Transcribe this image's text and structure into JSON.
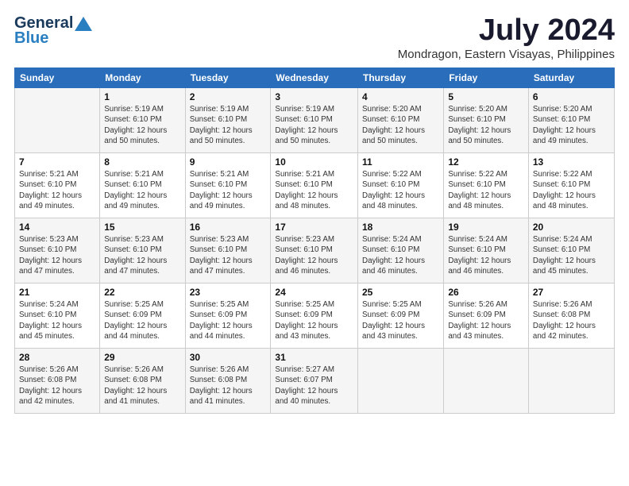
{
  "header": {
    "logo_line1": "General",
    "logo_line2": "Blue",
    "month_year": "July 2024",
    "location": "Mondragon, Eastern Visayas, Philippines"
  },
  "weekdays": [
    "Sunday",
    "Monday",
    "Tuesday",
    "Wednesday",
    "Thursday",
    "Friday",
    "Saturday"
  ],
  "weeks": [
    [
      {
        "day": "",
        "info": ""
      },
      {
        "day": "1",
        "info": "Sunrise: 5:19 AM\nSunset: 6:10 PM\nDaylight: 12 hours\nand 50 minutes."
      },
      {
        "day": "2",
        "info": "Sunrise: 5:19 AM\nSunset: 6:10 PM\nDaylight: 12 hours\nand 50 minutes."
      },
      {
        "day": "3",
        "info": "Sunrise: 5:19 AM\nSunset: 6:10 PM\nDaylight: 12 hours\nand 50 minutes."
      },
      {
        "day": "4",
        "info": "Sunrise: 5:20 AM\nSunset: 6:10 PM\nDaylight: 12 hours\nand 50 minutes."
      },
      {
        "day": "5",
        "info": "Sunrise: 5:20 AM\nSunset: 6:10 PM\nDaylight: 12 hours\nand 50 minutes."
      },
      {
        "day": "6",
        "info": "Sunrise: 5:20 AM\nSunset: 6:10 PM\nDaylight: 12 hours\nand 49 minutes."
      }
    ],
    [
      {
        "day": "7",
        "info": "Sunrise: 5:21 AM\nSunset: 6:10 PM\nDaylight: 12 hours\nand 49 minutes."
      },
      {
        "day": "8",
        "info": "Sunrise: 5:21 AM\nSunset: 6:10 PM\nDaylight: 12 hours\nand 49 minutes."
      },
      {
        "day": "9",
        "info": "Sunrise: 5:21 AM\nSunset: 6:10 PM\nDaylight: 12 hours\nand 49 minutes."
      },
      {
        "day": "10",
        "info": "Sunrise: 5:21 AM\nSunset: 6:10 PM\nDaylight: 12 hours\nand 48 minutes."
      },
      {
        "day": "11",
        "info": "Sunrise: 5:22 AM\nSunset: 6:10 PM\nDaylight: 12 hours\nand 48 minutes."
      },
      {
        "day": "12",
        "info": "Sunrise: 5:22 AM\nSunset: 6:10 PM\nDaylight: 12 hours\nand 48 minutes."
      },
      {
        "day": "13",
        "info": "Sunrise: 5:22 AM\nSunset: 6:10 PM\nDaylight: 12 hours\nand 48 minutes."
      }
    ],
    [
      {
        "day": "14",
        "info": "Sunrise: 5:23 AM\nSunset: 6:10 PM\nDaylight: 12 hours\nand 47 minutes."
      },
      {
        "day": "15",
        "info": "Sunrise: 5:23 AM\nSunset: 6:10 PM\nDaylight: 12 hours\nand 47 minutes."
      },
      {
        "day": "16",
        "info": "Sunrise: 5:23 AM\nSunset: 6:10 PM\nDaylight: 12 hours\nand 47 minutes."
      },
      {
        "day": "17",
        "info": "Sunrise: 5:23 AM\nSunset: 6:10 PM\nDaylight: 12 hours\nand 46 minutes."
      },
      {
        "day": "18",
        "info": "Sunrise: 5:24 AM\nSunset: 6:10 PM\nDaylight: 12 hours\nand 46 minutes."
      },
      {
        "day": "19",
        "info": "Sunrise: 5:24 AM\nSunset: 6:10 PM\nDaylight: 12 hours\nand 46 minutes."
      },
      {
        "day": "20",
        "info": "Sunrise: 5:24 AM\nSunset: 6:10 PM\nDaylight: 12 hours\nand 45 minutes."
      }
    ],
    [
      {
        "day": "21",
        "info": "Sunrise: 5:24 AM\nSunset: 6:10 PM\nDaylight: 12 hours\nand 45 minutes."
      },
      {
        "day": "22",
        "info": "Sunrise: 5:25 AM\nSunset: 6:09 PM\nDaylight: 12 hours\nand 44 minutes."
      },
      {
        "day": "23",
        "info": "Sunrise: 5:25 AM\nSunset: 6:09 PM\nDaylight: 12 hours\nand 44 minutes."
      },
      {
        "day": "24",
        "info": "Sunrise: 5:25 AM\nSunset: 6:09 PM\nDaylight: 12 hours\nand 43 minutes."
      },
      {
        "day": "25",
        "info": "Sunrise: 5:25 AM\nSunset: 6:09 PM\nDaylight: 12 hours\nand 43 minutes."
      },
      {
        "day": "26",
        "info": "Sunrise: 5:26 AM\nSunset: 6:09 PM\nDaylight: 12 hours\nand 43 minutes."
      },
      {
        "day": "27",
        "info": "Sunrise: 5:26 AM\nSunset: 6:08 PM\nDaylight: 12 hours\nand 42 minutes."
      }
    ],
    [
      {
        "day": "28",
        "info": "Sunrise: 5:26 AM\nSunset: 6:08 PM\nDaylight: 12 hours\nand 42 minutes."
      },
      {
        "day": "29",
        "info": "Sunrise: 5:26 AM\nSunset: 6:08 PM\nDaylight: 12 hours\nand 41 minutes."
      },
      {
        "day": "30",
        "info": "Sunrise: 5:26 AM\nSunset: 6:08 PM\nDaylight: 12 hours\nand 41 minutes."
      },
      {
        "day": "31",
        "info": "Sunrise: 5:27 AM\nSunset: 6:07 PM\nDaylight: 12 hours\nand 40 minutes."
      },
      {
        "day": "",
        "info": ""
      },
      {
        "day": "",
        "info": ""
      },
      {
        "day": "",
        "info": ""
      }
    ]
  ]
}
